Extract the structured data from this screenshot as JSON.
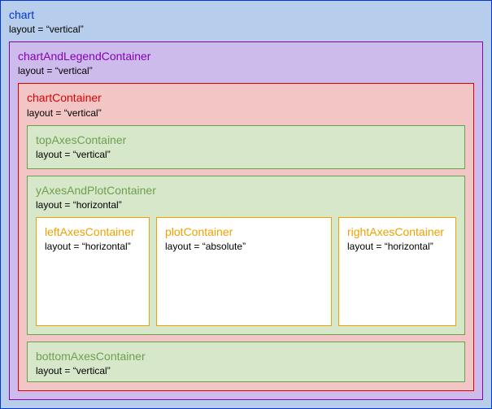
{
  "chart": {
    "title": "chart",
    "layout": "layout = “vertical”"
  },
  "chartAndLegend": {
    "title": "chartAndLegendContainer",
    "layout": "layout = “vertical”"
  },
  "chartContainer": {
    "title": "chartContainer",
    "layout": "layout = “vertical”"
  },
  "topAxes": {
    "title": "topAxesContainer",
    "layout": "layout = “vertical”"
  },
  "yAxesPlot": {
    "title": "yAxesAndPlotContainer",
    "layout": "layout = “horizontal”"
  },
  "leftAxes": {
    "title": "leftAxesContainer",
    "layout": "layout = “horizontal”"
  },
  "plot": {
    "title": "plotContainer",
    "layout": "layout = “absolute”"
  },
  "rightAxes": {
    "title": "rightAxesContainer",
    "layout": "layout = “horizontal”"
  },
  "bottomAxes": {
    "title": "bottomAxesContainer",
    "layout": "layout = “vertical”"
  }
}
